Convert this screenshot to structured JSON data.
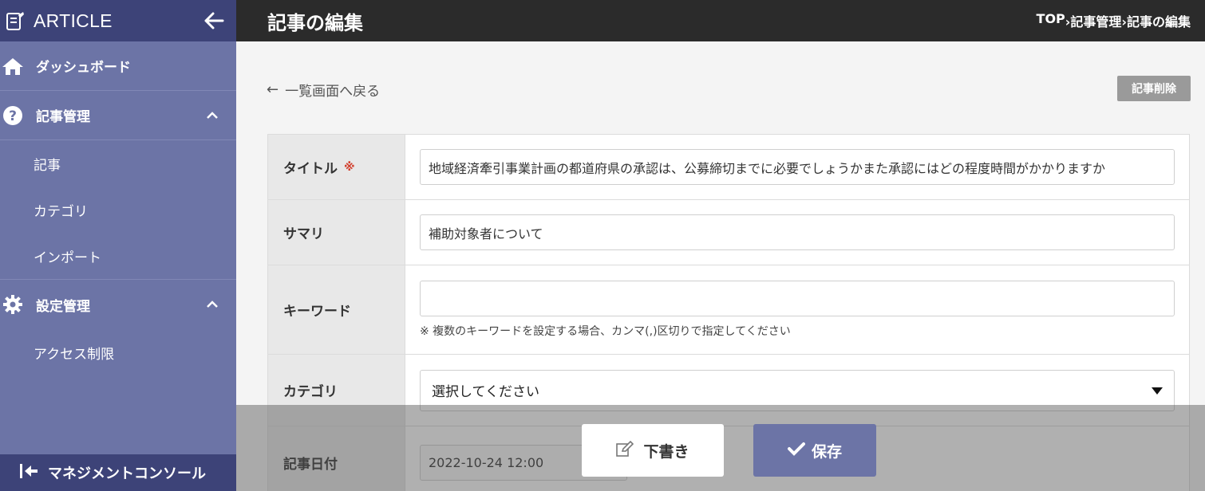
{
  "sidebar": {
    "brand": "ARTICLE",
    "menu": {
      "dashboard": "ダッシュボード",
      "articles_group": "記事管理",
      "articles": "記事",
      "categories": "カテゴリ",
      "import": "インポート",
      "settings_group": "設定管理",
      "access": "アクセス制限"
    },
    "console": "マネジメントコンソール"
  },
  "header": {
    "title": "記事の編集",
    "breadcrumb": [
      "TOP",
      " ›記事管理",
      " ›記事の編集"
    ]
  },
  "main": {
    "back": "一覧画面へ戻る",
    "delete": "記事削除"
  },
  "form": {
    "title_label": "タイトル",
    "required_mark": "※",
    "title_value": "地域経済牽引事業計画の都道府県の承認は、公募締切までに必要でしょうかまた承認にはどの程度時間がかかりますか",
    "summary_label": "サマリ",
    "summary_value": "補助対象者について",
    "keyword_label": "キーワード",
    "keyword_value": "",
    "keyword_hint": "※ 複数のキーワードを設定する場合、カンマ(,)区切りで指定してください",
    "category_label": "カテゴリ",
    "category_value": "選択してください",
    "date_label": "記事日付",
    "date_value": "2022-10-24 12:00"
  },
  "actions": {
    "draft": "下書き",
    "save": "保存"
  },
  "colors": {
    "sidebar": "#6c74a6",
    "sidebar_dark": "#3d4378",
    "header": "#2b2b2b",
    "required": "#d2402e"
  }
}
